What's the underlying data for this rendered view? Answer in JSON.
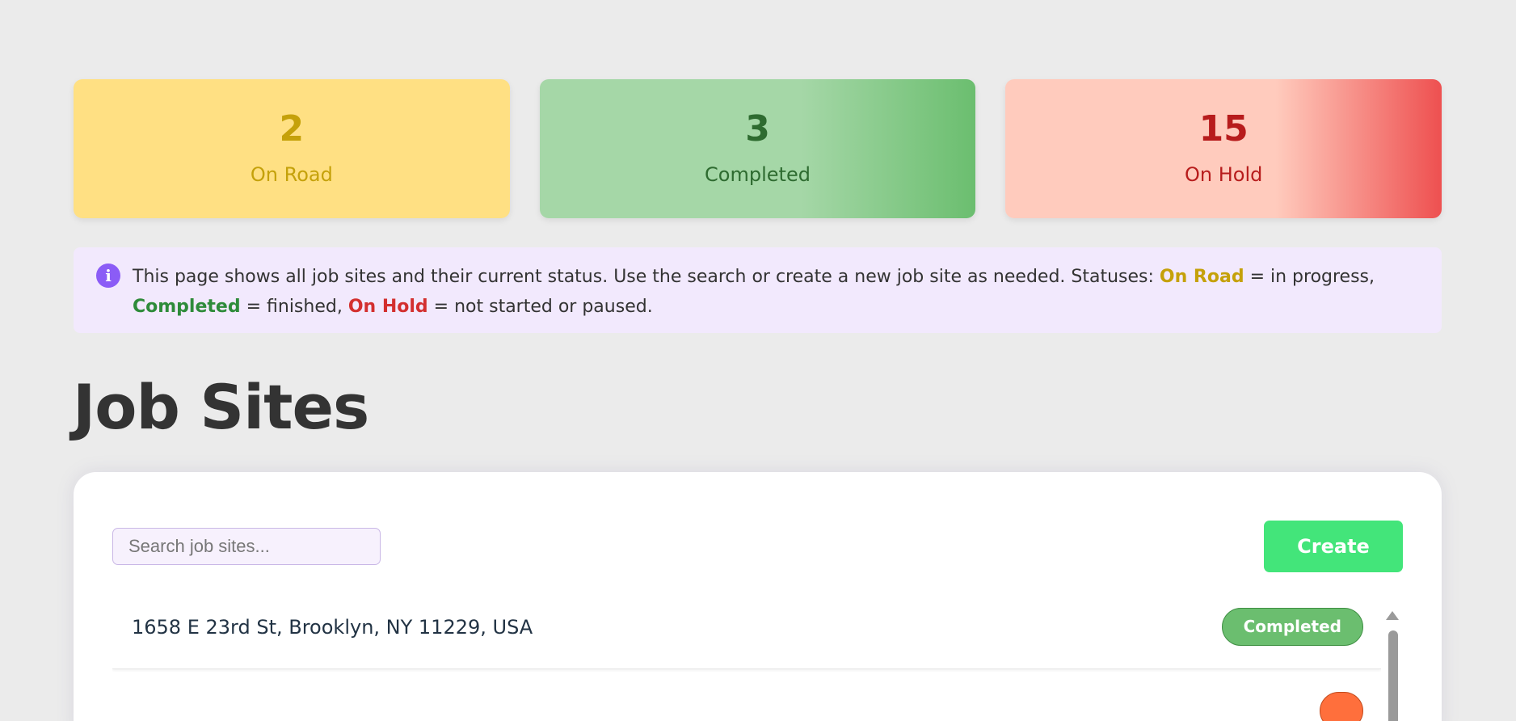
{
  "stats": [
    {
      "count": "2",
      "label": "On Road"
    },
    {
      "count": "3",
      "label": "Completed"
    },
    {
      "count": "15",
      "label": "On Hold"
    }
  ],
  "info": {
    "icon": "info-icon",
    "text_before": "This page shows all job sites and their current status. Use the search or create a new job site as needed. Statuses: ",
    "on_road": "On Road",
    "on_road_desc": " = in progress, ",
    "completed": "Completed",
    "completed_desc": " = finished, ",
    "on_hold": "On Hold",
    "on_hold_desc": " = not started or paused."
  },
  "title": "Job Sites",
  "search": {
    "placeholder": "Search job sites...",
    "value": ""
  },
  "create_label": "Create",
  "job_sites": [
    {
      "address": "1658 E 23rd St, Brooklyn, NY 11229, USA",
      "status": "Completed"
    },
    {
      "address": "",
      "status": ""
    }
  ],
  "colors": {
    "on_road": "#ffe083",
    "completed": "#6bbe6f",
    "on_hold": "#ee5050",
    "create": "#43e57a",
    "accent": "#8b5cf6"
  }
}
